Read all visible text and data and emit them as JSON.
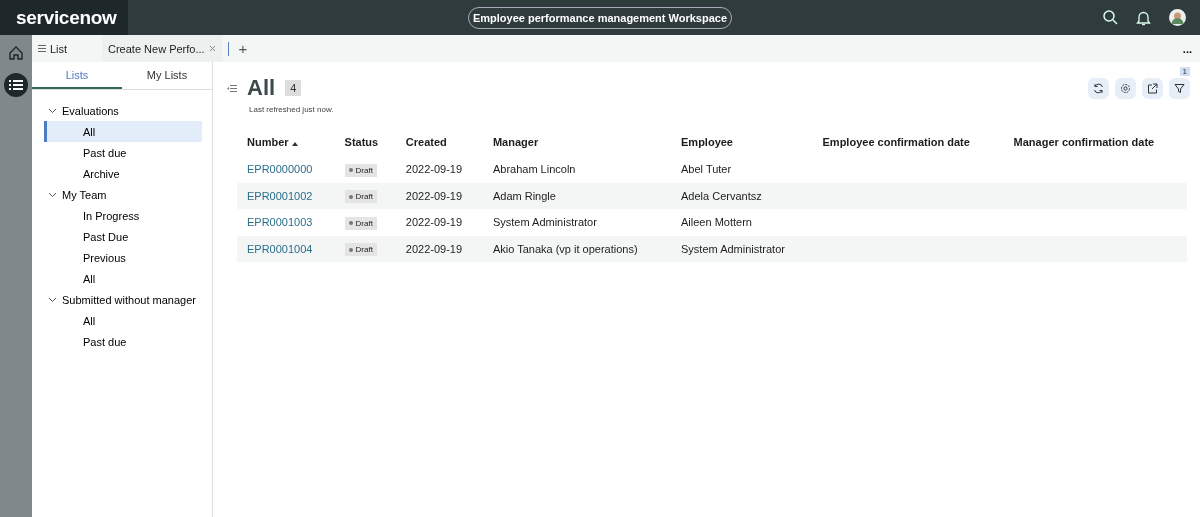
{
  "header": {
    "logo": "servicenow",
    "workspace_title": "Employee performance management Workspace"
  },
  "tabs": [
    {
      "label": "List",
      "selected": true,
      "closable": false
    },
    {
      "label": "Create New Perfo...",
      "selected": false,
      "closable": true
    }
  ],
  "new_tab": "+",
  "more": "...",
  "list_tabs": [
    {
      "label": "Lists",
      "selected": true
    },
    {
      "label": "My Lists",
      "selected": false
    }
  ],
  "tree": [
    {
      "label": "Evaluations",
      "expanded": true,
      "children": [
        {
          "label": "All",
          "selected": true
        },
        {
          "label": "Past due",
          "selected": false
        },
        {
          "label": "Archive",
          "selected": false
        }
      ]
    },
    {
      "label": "My Team",
      "expanded": true,
      "children": [
        {
          "label": "In Progress",
          "selected": false
        },
        {
          "label": "Past Due",
          "selected": false
        },
        {
          "label": "Previous",
          "selected": false
        },
        {
          "label": "All",
          "selected": false
        }
      ]
    },
    {
      "label": "Submitted without manager",
      "expanded": true,
      "children": [
        {
          "label": "All",
          "selected": false
        },
        {
          "label": "Past due",
          "selected": false
        }
      ]
    }
  ],
  "list": {
    "title": "All",
    "count": "4",
    "refreshed": "Last refreshed just now.",
    "filter_count": "1"
  },
  "table": {
    "columns": [
      {
        "label": "Number",
        "sorted": true
      },
      {
        "label": "Status",
        "sorted": false
      },
      {
        "label": "Created",
        "sorted": false
      },
      {
        "label": "Manager",
        "sorted": false
      },
      {
        "label": "Employee",
        "sorted": false
      },
      {
        "label": "Employee confirmation date",
        "sorted": false
      },
      {
        "label": "Manager confirmation date",
        "sorted": false
      }
    ],
    "rows": [
      {
        "number": "EPR0000000",
        "status": "Draft",
        "created": "2022-09-19",
        "manager": "Abraham Lincoln",
        "employee": "Abel Tuter"
      },
      {
        "number": "EPR0001002",
        "status": "Draft",
        "created": "2022-09-19",
        "manager": "Adam Ringle",
        "employee": "Adela Cervantsz"
      },
      {
        "number": "EPR0001003",
        "status": "Draft",
        "created": "2022-09-19",
        "manager": "System Administrator",
        "employee": "Aileen Mottern"
      },
      {
        "number": "EPR0001004",
        "status": "Draft",
        "created": "2022-09-19",
        "manager": "Akio Tanaka (vp it operations)",
        "employee": "System Administrator"
      }
    ]
  }
}
